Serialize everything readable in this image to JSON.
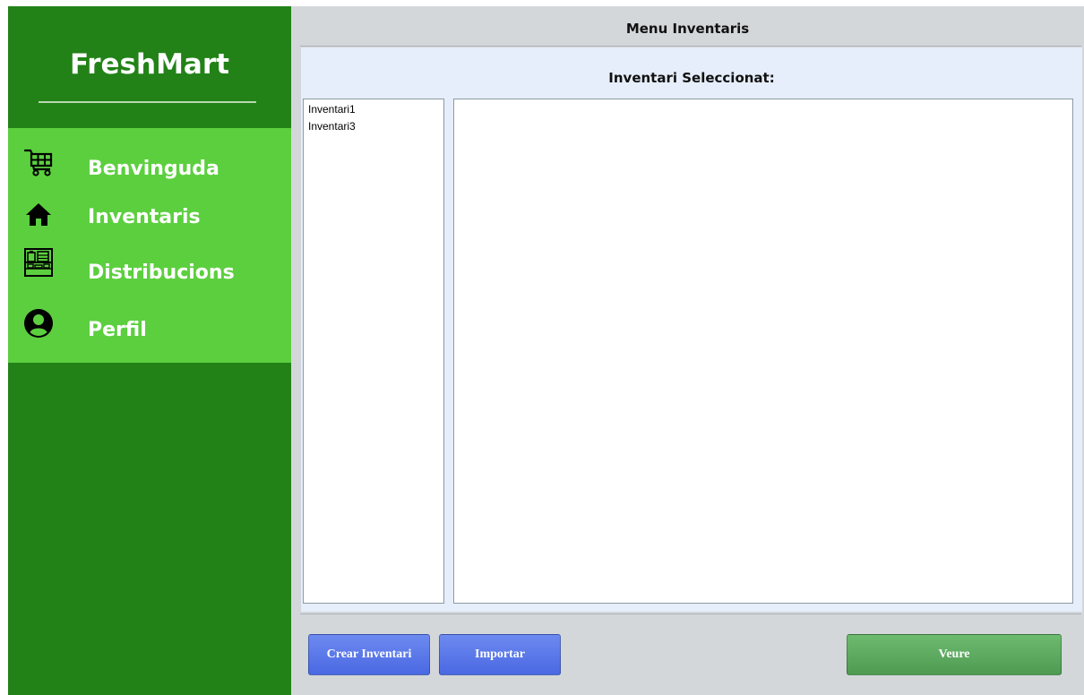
{
  "app": {
    "brand": "FreshMart",
    "colors": {
      "sidebar_dark": "#228217",
      "sidebar_light": "#5ccf3f",
      "main_bg": "#d3d7da",
      "content_bg": "#e6eefb",
      "button_blue": "#4a68e2",
      "button_green": "#4e9a52"
    }
  },
  "sidebar": {
    "items": [
      {
        "label": "Benvinguda",
        "icon": "shopping-cart-icon"
      },
      {
        "label": "Inventaris",
        "icon": "home-icon"
      },
      {
        "label": "Distribucions",
        "icon": "store-shelf-icon"
      },
      {
        "label": "Perfil",
        "icon": "user-profile-icon"
      }
    ]
  },
  "main": {
    "title": "Menu Inventaris",
    "selected_label": "Inventari Seleccionat:",
    "inventories": [
      "Inventari1",
      "Inventari3"
    ]
  },
  "buttons": {
    "create": "Crear Inventari",
    "import": "Importar",
    "view": "Veure"
  }
}
